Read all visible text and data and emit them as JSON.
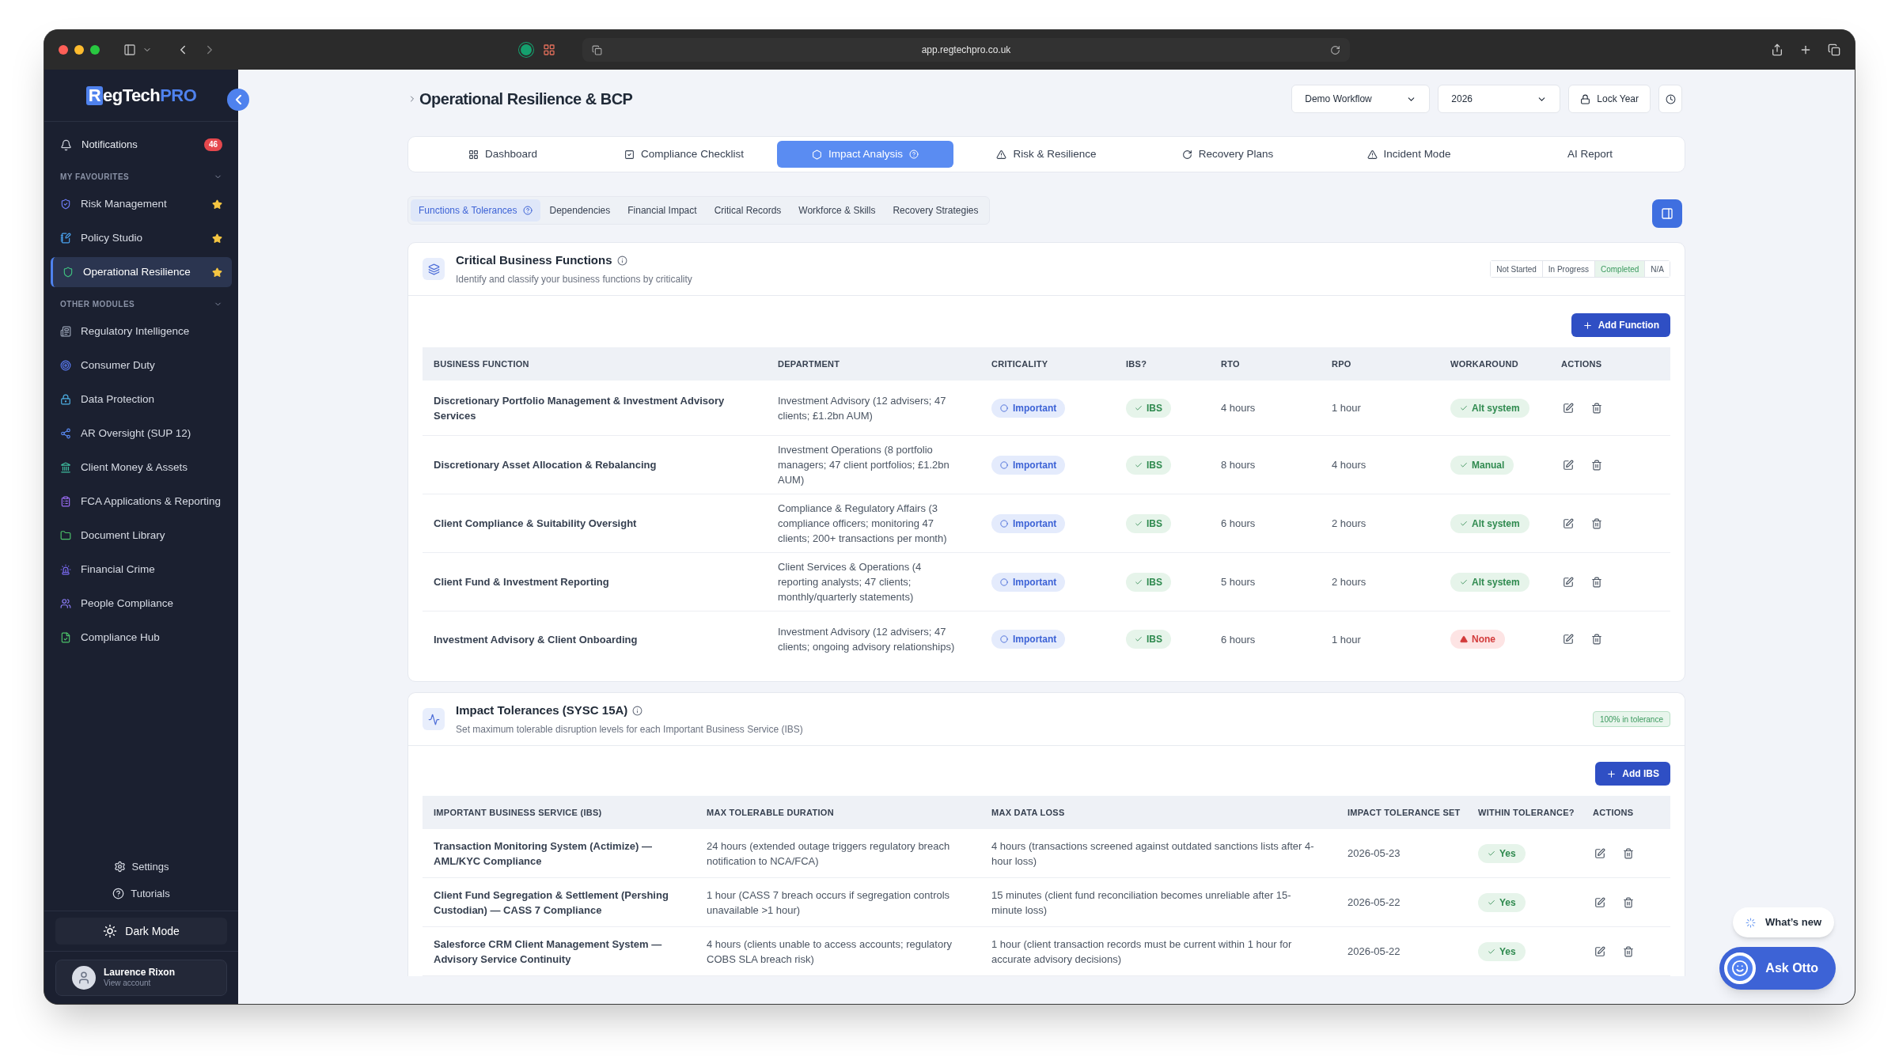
{
  "browser": {
    "url": "app.regtechpro.co.uk"
  },
  "sidebar": {
    "logo": {
      "initial": "R",
      "middle": "egTech",
      "suffix": "PRO"
    },
    "notifications": {
      "label": "Notifications",
      "count": "46"
    },
    "favourites": {
      "heading": "MY FAVOURITES",
      "items": [
        {
          "label": "Risk Management",
          "selected": false,
          "starred": true
        },
        {
          "label": "Policy Studio",
          "selected": false,
          "starred": true
        },
        {
          "label": "Operational Resilience",
          "selected": true,
          "starred": true
        }
      ]
    },
    "other_modules": {
      "heading": "OTHER MODULES",
      "items": [
        {
          "label": "Regulatory Intelligence",
          "selected": false
        },
        {
          "label": "Consumer Duty",
          "selected": false
        },
        {
          "label": "Data Protection",
          "selected": false
        },
        {
          "label": "AR Oversight (SUP 12)",
          "selected": false
        },
        {
          "label": "Client Money & Assets",
          "selected": false
        },
        {
          "label": "FCA Applications & Reporting",
          "selected": false
        },
        {
          "label": "Document Library",
          "selected": false
        },
        {
          "label": "Financial Crime",
          "selected": false
        },
        {
          "label": "People Compliance",
          "selected": false
        },
        {
          "label": "Compliance Hub",
          "selected": false
        }
      ]
    },
    "footer": {
      "settings": "Settings",
      "tutorials": "Tutorials",
      "dark_mode": "Dark Mode"
    },
    "user": {
      "name": "Laurence Rixon",
      "subtitle": "View account"
    }
  },
  "header": {
    "title": "Operational Resilience & BCP",
    "workflow": "Demo Workflow",
    "year": "2026",
    "lock": "Lock Year"
  },
  "tabs": [
    {
      "label": "Dashboard",
      "selected": false,
      "help": false
    },
    {
      "label": "Compliance Checklist",
      "selected": false,
      "help": false
    },
    {
      "label": "Impact Analysis",
      "selected": true,
      "help": true
    },
    {
      "label": "Risk & Resilience",
      "selected": false,
      "help": false
    },
    {
      "label": "Recovery Plans",
      "selected": false,
      "help": false
    },
    {
      "label": "Incident Mode",
      "selected": false,
      "help": false
    },
    {
      "label": "AI Report",
      "selected": false,
      "help": false
    }
  ],
  "subtabs": [
    {
      "label": "Functions & Tolerances",
      "selected": true,
      "help": true
    },
    {
      "label": "Dependencies",
      "selected": false,
      "help": false
    },
    {
      "label": "Financial Impact",
      "selected": false,
      "help": false
    },
    {
      "label": "Critical Records",
      "selected": false,
      "help": false
    },
    {
      "label": "Workforce & Skills",
      "selected": false,
      "help": false
    },
    {
      "label": "Recovery Strategies",
      "selected": false,
      "help": false
    }
  ],
  "functions_card": {
    "title": "Critical Business Functions",
    "subtitle": "Identify and classify your business functions by criticality",
    "status_filters": [
      {
        "label": "Not Started",
        "selected": false
      },
      {
        "label": "In Progress",
        "selected": false
      },
      {
        "label": "Completed",
        "selected": true
      },
      {
        "label": "N/A",
        "selected": false
      }
    ],
    "add_button": "Add Function",
    "columns": [
      "BUSINESS FUNCTION",
      "DEPARTMENT",
      "CRITICALITY",
      "IBS?",
      "RTO",
      "RPO",
      "WORKAROUND",
      "ACTIONS"
    ],
    "rows": [
      {
        "function": "Discretionary Portfolio Management & Investment Advisory Services",
        "department": "Investment Advisory (12 advisers; 47 clients; £1.2bn AUM)",
        "criticality": "Important",
        "ibs": "IBS",
        "rto": "4 hours",
        "rpo": "1 hour",
        "workaround": {
          "label": "Alt system",
          "kind": "ok"
        }
      },
      {
        "function": "Discretionary Asset Allocation & Rebalancing",
        "department": "Investment Operations (8 portfolio managers; 47 client portfolios; £1.2bn AUM)",
        "criticality": "Important",
        "ibs": "IBS",
        "rto": "8 hours",
        "rpo": "4 hours",
        "workaround": {
          "label": "Manual",
          "kind": "ok"
        }
      },
      {
        "function": "Client Compliance & Suitability Oversight",
        "department": "Compliance & Regulatory Affairs (3 compliance officers; monitoring 47 clients; 200+ transactions per month)",
        "criticality": "Important",
        "ibs": "IBS",
        "rto": "6 hours",
        "rpo": "2 hours",
        "workaround": {
          "label": "Alt system",
          "kind": "ok"
        }
      },
      {
        "function": "Client Fund & Investment Reporting",
        "department": "Client Services & Operations (4 reporting analysts; 47 clients; monthly/quarterly statements)",
        "criticality": "Important",
        "ibs": "IBS",
        "rto": "5 hours",
        "rpo": "2 hours",
        "workaround": {
          "label": "Alt system",
          "kind": "ok"
        }
      },
      {
        "function": "Investment Advisory & Client Onboarding",
        "department": "Investment Advisory (12 advisers; 47 clients; ongoing advisory relationships)",
        "criticality": "Important",
        "ibs": "IBS",
        "rto": "6 hours",
        "rpo": "1 hour",
        "workaround": {
          "label": "None",
          "kind": "none"
        }
      }
    ]
  },
  "tolerances_card": {
    "title": "Impact Tolerances (SYSC 15A)",
    "subtitle": "Set maximum tolerable disruption levels for each Important Business Service (IBS)",
    "badge": "100% in tolerance",
    "add_button": "Add IBS",
    "columns": [
      "IMPORTANT BUSINESS SERVICE (IBS)",
      "MAX TOLERABLE DURATION",
      "MAX DATA LOSS",
      "IMPACT TOLERANCE SET",
      "WITHIN TOLERANCE?",
      "ACTIONS"
    ],
    "rows": [
      {
        "service": "Transaction Monitoring System (Actimize) — AML/KYC Compliance",
        "duration": "24 hours (extended outage triggers regulatory breach notification to NCA/FCA)",
        "data_loss": "4 hours (transactions screened against outdated sanctions lists after 4-hour loss)",
        "date": "2026-05-23",
        "within": {
          "label": "Yes",
          "kind": "ok"
        }
      },
      {
        "service": "Client Fund Segregation & Settlement (Pershing Custodian) — CASS 7 Compliance",
        "duration": "1 hour (CASS 7 breach occurs if segregation controls unavailable >1 hour)",
        "data_loss": "15 minutes (client fund reconciliation becomes unreliable after 15-minute loss)",
        "date": "2026-05-22",
        "within": {
          "label": "Yes",
          "kind": "ok"
        }
      },
      {
        "service": "Salesforce CRM Client Management System — Advisory Service Continuity",
        "duration": "4 hours (clients unable to access accounts; regulatory COBS SLA breach risk)",
        "data_loss": "1 hour (client transaction records must be current within 1 hour for accurate advisory decisions)",
        "date": "2026-05-22",
        "within": {
          "label": "Yes",
          "kind": "ok"
        }
      }
    ]
  },
  "floating": {
    "whats_new": "What’s new",
    "ask": "Ask Otto"
  }
}
